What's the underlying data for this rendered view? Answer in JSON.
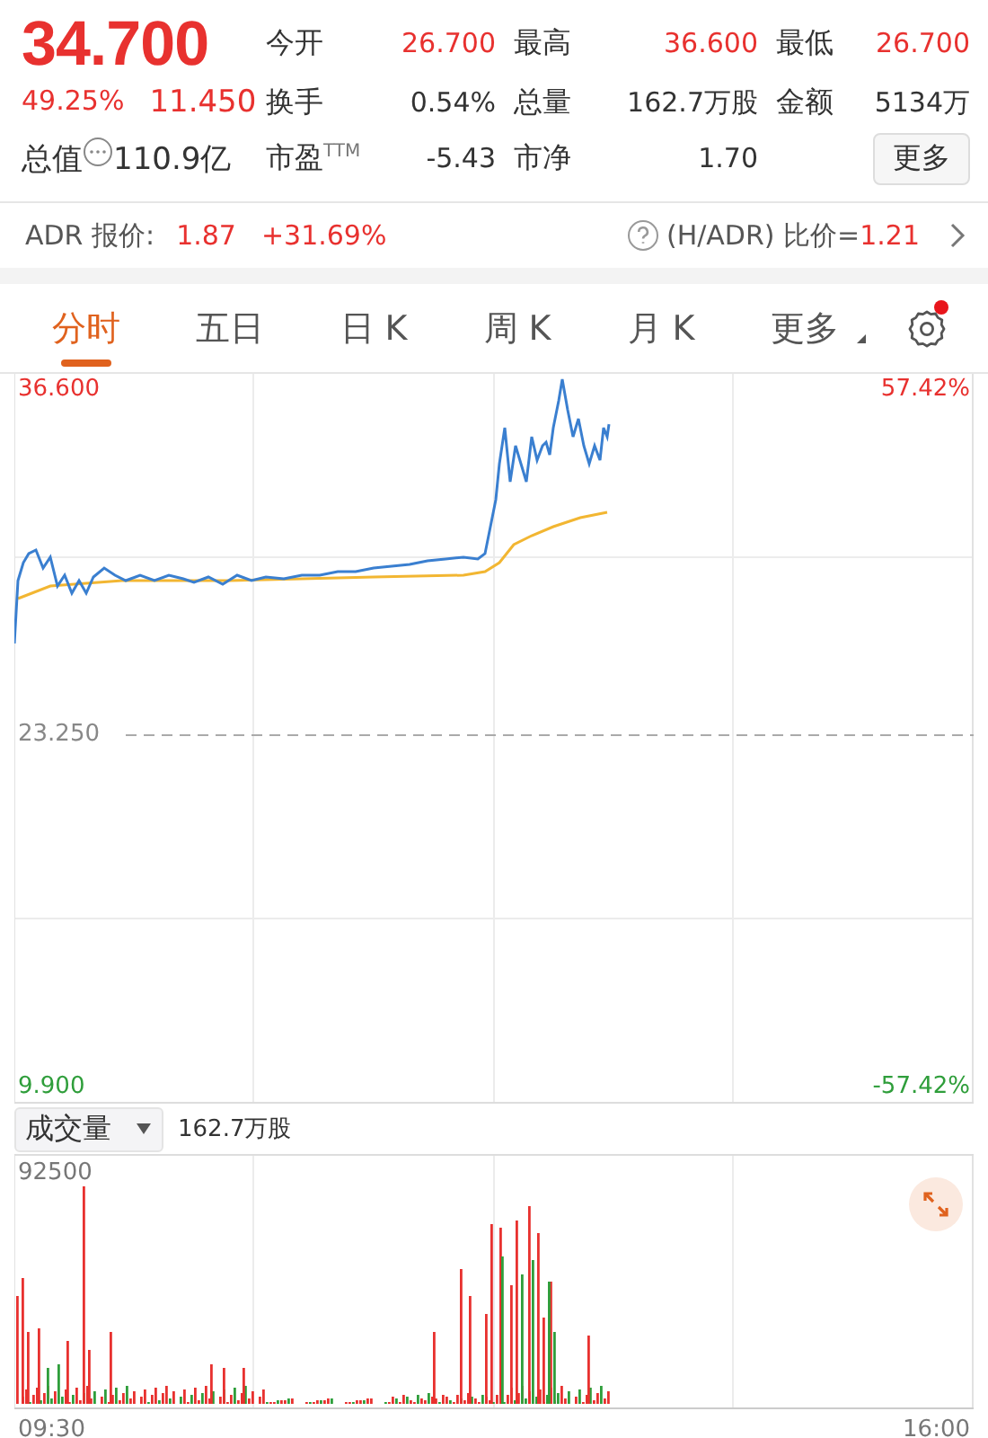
{
  "quote": {
    "price": "34.700",
    "change_pct": "49.25%",
    "change": "11.450",
    "stats": [
      {
        "label": "今开",
        "value": "26.700",
        "color": "#e8312f"
      },
      {
        "label": "最高",
        "value": "36.600",
        "color": "#e8312f"
      },
      {
        "label": "最低",
        "value": "26.700",
        "color": "#e8312f"
      },
      {
        "label": "换手",
        "value": "0.54%",
        "color": "#333333"
      },
      {
        "label": "总量",
        "value": "162.7万股",
        "color": "#333333"
      },
      {
        "label": "金额",
        "value": "5134万",
        "color": "#333333"
      },
      {
        "label": "市盈$^{TTM}$",
        "value": "-5.43",
        "color": "#333333"
      },
      {
        "label": "市净",
        "value": "1.70",
        "color": "#333333"
      }
    ],
    "market_cap": {
      "label": "总值",
      "value": "110.9亿"
    },
    "more_button": "更多"
  },
  "adr": {
    "label": "ADR 报价:",
    "price": "1.87",
    "change": "+31.69%",
    "ratio_label": "(H/ADR) 比价=",
    "ratio": "1.21"
  },
  "tabs": [
    {
      "label": "分时",
      "selected": true
    },
    {
      "label": "五日",
      "selected": false
    },
    {
      "label": "日 K",
      "selected": false
    },
    {
      "label": "周 K",
      "selected": false
    },
    {
      "label": "月 K",
      "selected": false
    },
    {
      "label": "更多",
      "selected": false,
      "kind": "menu"
    }
  ],
  "settings": {
    "notification": true
  },
  "price_chart": {
    "y_high": "36.600",
    "y_mid": "23.250",
    "y_low": "9.900",
    "pct_high": "57.42%",
    "pct_low": "-57.42%"
  },
  "volume": {
    "selector": "成交量",
    "total": "162.7万股",
    "y_max": "92500",
    "time_start": "09:30",
    "time_end": "16:00"
  }
}
